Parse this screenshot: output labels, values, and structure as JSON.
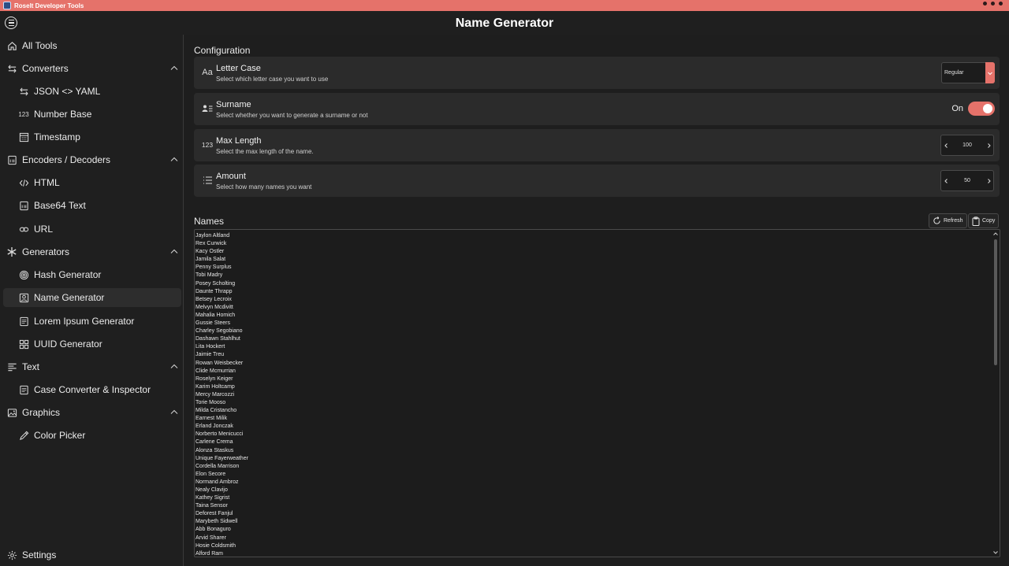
{
  "window": {
    "title": "Roselt Developer Tools"
  },
  "header": {
    "title": "Name Generator"
  },
  "sidebar": {
    "items": [
      {
        "label": "All Tools",
        "icon": "home-icon",
        "level": "top",
        "active": false,
        "expandable": false
      },
      {
        "label": "Converters",
        "icon": "arrows-swap-icon",
        "level": "top",
        "active": false,
        "expandable": true
      },
      {
        "label": "JSON <> YAML",
        "icon": "arrows-swap-icon",
        "level": "sub",
        "active": false,
        "expandable": false
      },
      {
        "label": "Number Base",
        "icon": "number-123-icon",
        "level": "sub",
        "active": false,
        "expandable": false
      },
      {
        "label": "Timestamp",
        "icon": "calendar-icon",
        "level": "sub",
        "active": false,
        "expandable": false
      },
      {
        "label": "Encoders / Decoders",
        "icon": "binary-file-icon",
        "level": "top",
        "active": false,
        "expandable": true
      },
      {
        "label": "HTML",
        "icon": "code-icon",
        "level": "sub",
        "active": false,
        "expandable": false
      },
      {
        "label": "Base64 Text",
        "icon": "binary-file-icon",
        "level": "sub",
        "active": false,
        "expandable": false
      },
      {
        "label": "URL",
        "icon": "link-icon",
        "level": "sub",
        "active": false,
        "expandable": false
      },
      {
        "label": "Generators",
        "icon": "asterisk-icon",
        "level": "top",
        "active": false,
        "expandable": true
      },
      {
        "label": "Hash Generator",
        "icon": "fingerprint-icon",
        "level": "sub",
        "active": false,
        "expandable": false
      },
      {
        "label": "Name Generator",
        "icon": "contact-card-icon",
        "level": "sub",
        "active": true,
        "expandable": false
      },
      {
        "label": "Lorem Ipsum Generator",
        "icon": "text-box-icon",
        "level": "sub",
        "active": false,
        "expandable": false
      },
      {
        "label": "UUID Generator",
        "icon": "grid-icon",
        "level": "sub",
        "active": false,
        "expandable": false
      },
      {
        "label": "Text",
        "icon": "text-align-icon",
        "level": "top",
        "active": false,
        "expandable": true
      },
      {
        "label": "Case Converter & Inspector",
        "icon": "text-box-icon",
        "level": "sub",
        "active": false,
        "expandable": false
      },
      {
        "label": "Graphics",
        "icon": "image-icon",
        "level": "top",
        "active": false,
        "expandable": true
      },
      {
        "label": "Color Picker",
        "icon": "eyedropper-icon",
        "level": "sub",
        "active": false,
        "expandable": false
      }
    ],
    "settings_label": "Settings"
  },
  "config": {
    "title": "Configuration",
    "letter_case": {
      "icon": "letter-case-icon",
      "icon_text": "Aa",
      "title": "Letter Case",
      "description": "Select which letter case you want to use",
      "value": "Regular"
    },
    "surname": {
      "icon": "person-lines-icon",
      "title": "Surname",
      "description": "Select whether you want to generate a surname or not",
      "toggle_label": "On",
      "enabled": true
    },
    "max_length": {
      "icon": "number-123-icon",
      "icon_text": "123",
      "title": "Max Length",
      "description": "Select the max length of the name.",
      "value": "100"
    },
    "amount": {
      "icon": "list-icon",
      "title": "Amount",
      "description": "Select how many names you want",
      "value": "50"
    }
  },
  "names": {
    "title": "Names",
    "refresh_label": "Refresh",
    "copy_label": "Copy",
    "list": [
      "Jaylon Altland",
      "Rex Curwick",
      "Kacy Ostler",
      "Jamila Salat",
      "Penny Surplus",
      "Tobi Madry",
      "Posey Scholting",
      "Daunte Thrapp",
      "Betsey Lecroix",
      "Melvyn Mcdivitt",
      "Mahalia Homich",
      "Gussie Steers",
      "Charley Segobiano",
      "Dashawn Stahlhut",
      "Lita Hockert",
      "Jaimie Treu",
      "Rowan Weisbecker",
      "Clide Mcmurrian",
      "Roselyn Keiger",
      "Karim Holtcamp",
      "Mercy Marcozzi",
      "Torie Mooso",
      "Milda Cristancho",
      "Earnest Milik",
      "Erland Jonczak",
      "Norberto Menicucci",
      "Carlene Crema",
      "Alonza Staskus",
      "Unique Fayerweather",
      "Cordella Marrison",
      "Elon Secore",
      "Normand Ambroz",
      "Nealy Clavijo",
      "Kathey Sigrist",
      "Taina Sensor",
      "Deforest Fanjul",
      "Marybeth Sidwell",
      "Abb Bonaguro",
      "Arvid Sharer",
      "Hosie Coldsmith",
      "Alford Ram"
    ]
  },
  "colors": {
    "accent": "#e5726a",
    "background": "#1f1f1f",
    "card": "#2b2b2b"
  }
}
